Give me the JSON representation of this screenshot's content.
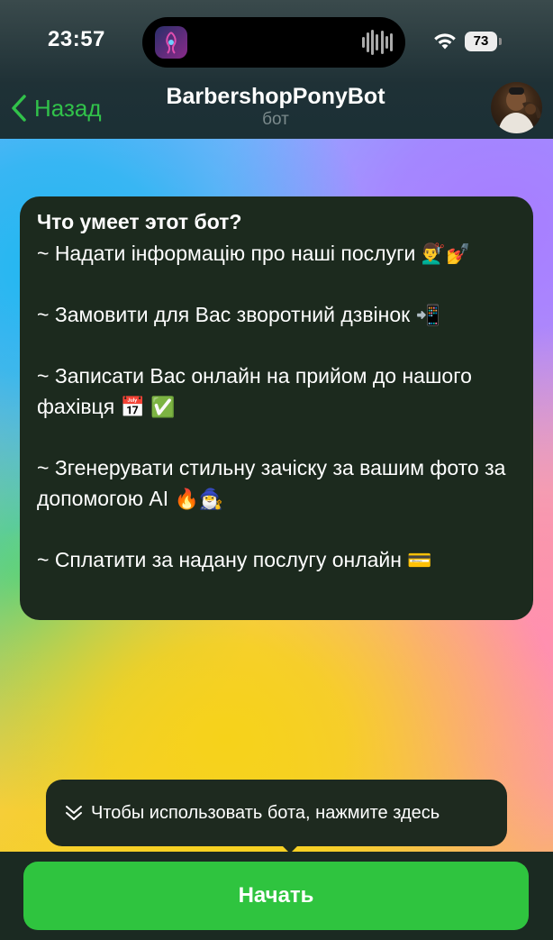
{
  "status_bar": {
    "time": "23:57",
    "battery": "73"
  },
  "nav": {
    "back_label": "Назад",
    "title": "BarbershopPonyBot",
    "subtitle": "бот"
  },
  "info": {
    "title": "Что умеет этот бот?",
    "items": [
      {
        "text": "~ Надати інформацію про наші послуги",
        "emoji": "💇‍♂️💅"
      },
      {
        "text": "~ Замовити для Вас зворотний дзвінок",
        "emoji": "📲"
      },
      {
        "text": "~ Записати Вас онлайн на прийом до нашого фахівця",
        "emoji": "📅 ✅"
      },
      {
        "text": "~ Згенерувати стильну зачіску за вашим фото за допомогою AI",
        "emoji": "🔥🧙‍♂️"
      },
      {
        "text": "~ Сплатити за надану послугу онлайн",
        "emoji": "💳"
      }
    ]
  },
  "tooltip": {
    "text": "Чтобы использовать бота, нажмите здесь"
  },
  "start_button": {
    "label": "Начать"
  },
  "colors": {
    "accent_green": "#31c24a",
    "button_green": "#2fc43f",
    "card_bg": "#1c2a1e"
  },
  "icons": {
    "back": "chevron-left-icon",
    "tooltip": "chevron-double-down-icon",
    "wifi": "wifi-icon",
    "battery": "battery-icon",
    "audio": "waveform-icon"
  }
}
